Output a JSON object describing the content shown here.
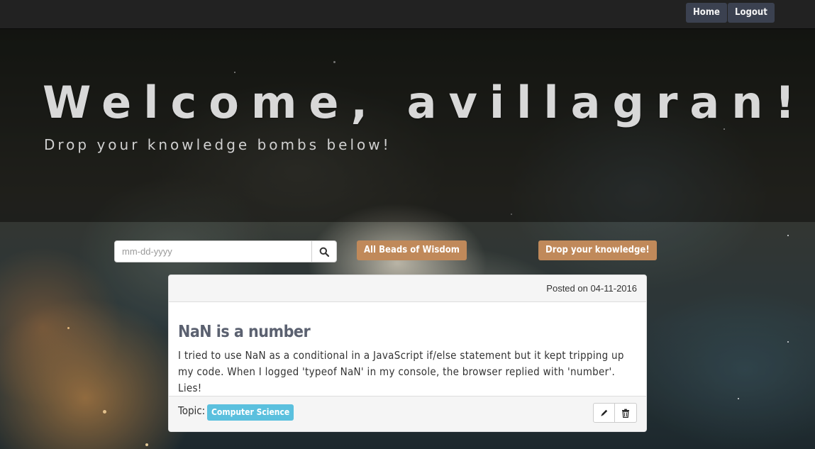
{
  "nav": {
    "home_label": "Home",
    "logout_label": "Logout"
  },
  "hero": {
    "title": "Welcome, avillagran!",
    "subtitle": "Drop your knowledge bombs below!"
  },
  "controls": {
    "date_placeholder": "mm-dd-yyyy",
    "all_beads_label": "All Beads of Wisdom",
    "drop_label": "Drop your knowledge!"
  },
  "post": {
    "posted": "Posted on 04-11-2016",
    "title": "NaN is a number",
    "body": "I tried to use NaN as a conditional in a JavaScript if/else statement but it kept tripping up my code. When I logged 'typeof NaN' in my console, the browser replied with 'number'. Lies!",
    "topic_label": "Topic:",
    "topic": "Computer Science"
  },
  "icons": [
    "search-icon",
    "pencil-icon",
    "trash-icon"
  ],
  "colors": {
    "navbar": "#222222",
    "nav_button": "#3b4150",
    "tan_button": "#c0895a",
    "topic_badge": "#5bc0de",
    "title_text": "#5b6170"
  }
}
